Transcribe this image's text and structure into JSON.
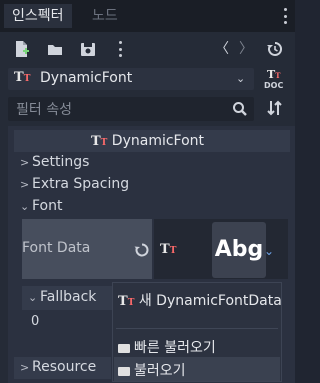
{
  "tabs": [
    {
      "label": "인스펙터",
      "active": true
    },
    {
      "label": "노드",
      "active": false
    }
  ],
  "toolbar": {
    "icons": [
      "new-resource-icon",
      "open-folder-icon",
      "save-icon",
      "more-icon"
    ],
    "nav_back": "〈",
    "nav_forward": "〉",
    "history_icon": "history-icon"
  },
  "resource": {
    "name": "DynamicFont",
    "doc_label": "DOC"
  },
  "filter": {
    "placeholder": "필터 속성"
  },
  "inspector": {
    "header": "DynamicFont",
    "sections": [
      {
        "label": "Settings",
        "expanded": false
      },
      {
        "label": "Extra Spacing",
        "expanded": false
      },
      {
        "label": "Font",
        "expanded": true
      }
    ],
    "font_data_label": "Font Data",
    "preview_text": "Abg",
    "fallback_label": "Fallback",
    "fallback_value": "0",
    "resource_label": "Resource"
  },
  "context_menu": {
    "items": [
      {
        "label": "새 DynamicFontData",
        "icon": "dynamic-font-icon"
      },
      {
        "label": "빠른 불러오기",
        "icon": "folder-icon"
      },
      {
        "label": "불러오기",
        "icon": "folder-icon",
        "highlighted": true
      }
    ]
  },
  "colors": {
    "background": "#202531",
    "panel": "#252b37",
    "accent_blue": "#6ea3e8",
    "font_icon_red": "#ff6b6b"
  }
}
